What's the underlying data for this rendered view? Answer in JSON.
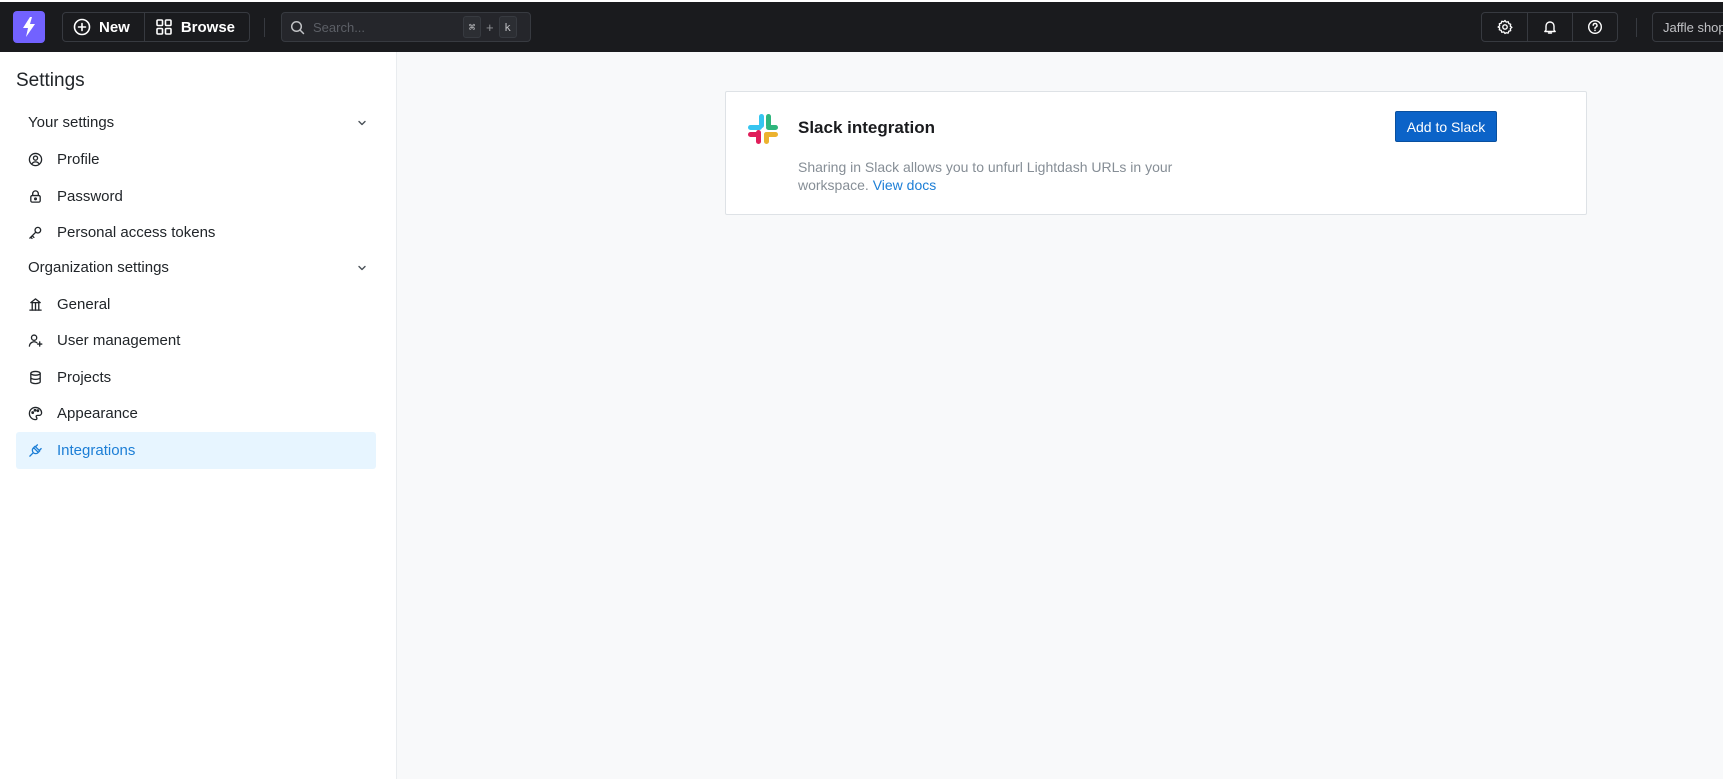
{
  "topbar": {
    "new_label": "New",
    "browse_label": "Browse",
    "search_placeholder": "Search...",
    "shortcut_key1": "⌘",
    "shortcut_plus": "+",
    "shortcut_key2": "k",
    "project_name": "Jaffle shop"
  },
  "sidebar": {
    "title": "Settings",
    "your_settings": {
      "label": "Your settings",
      "items": [
        {
          "label": "Profile",
          "icon": "user-circle-icon"
        },
        {
          "label": "Password",
          "icon": "lock-icon"
        },
        {
          "label": "Personal access tokens",
          "icon": "key-icon"
        }
      ]
    },
    "org_settings": {
      "label": "Organization settings",
      "items": [
        {
          "label": "General",
          "icon": "building-bank-icon"
        },
        {
          "label": "User management",
          "icon": "user-plus-icon"
        },
        {
          "label": "Projects",
          "icon": "database-icon"
        },
        {
          "label": "Appearance",
          "icon": "palette-icon"
        },
        {
          "label": "Integrations",
          "icon": "plug-icon",
          "active": true
        }
      ]
    }
  },
  "card": {
    "title": "Slack integration",
    "description": "Sharing in Slack allows you to unfurl Lightdash URLs in your workspace.",
    "docs_link": "View docs",
    "button_label": "Add to Slack"
  },
  "colors": {
    "brand": "#7262ff",
    "topbar_bg": "#1a1b1e",
    "active_bg": "#e7f5ff",
    "active_text": "#1c7ed6",
    "primary_button": "#0b63c8"
  }
}
